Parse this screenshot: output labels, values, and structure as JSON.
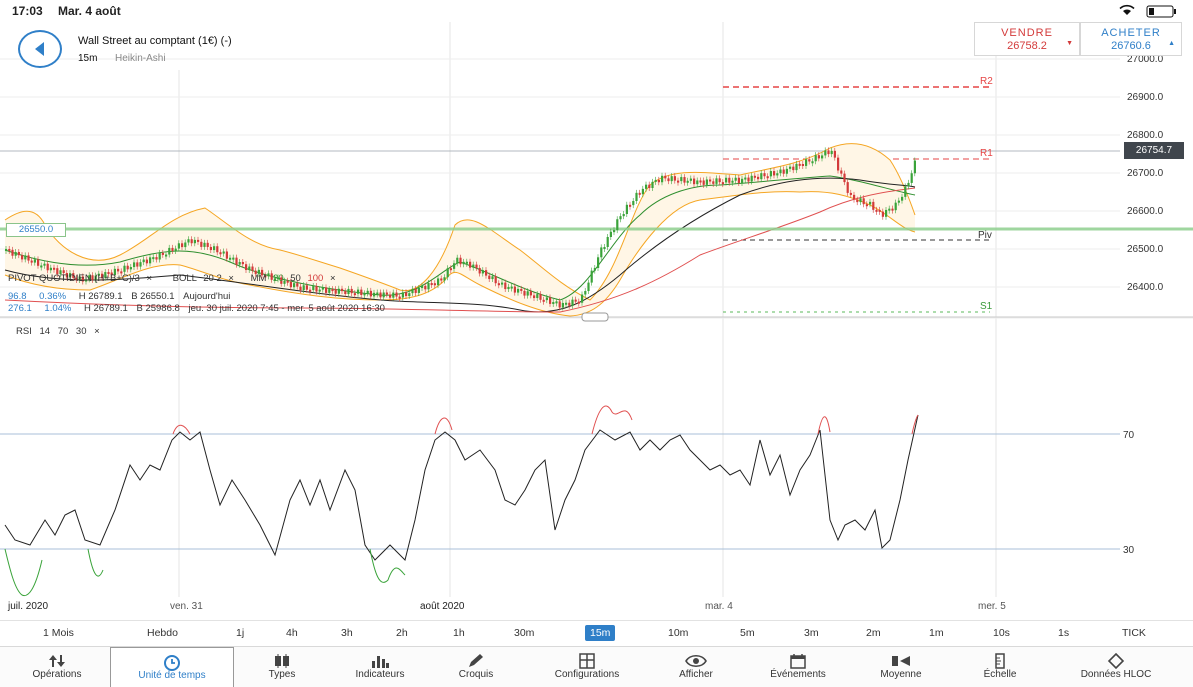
{
  "status_bar": {
    "time": "17:03",
    "date": "Mar. 4 août"
  },
  "header": {
    "instrument": "Wall Street au comptant (1€) (-)",
    "timeframe": "15m",
    "chart_type": "Heikin-Ashi"
  },
  "trade": {
    "sell_label": "VENDRE",
    "sell_price": "26758.2",
    "buy_label": "ACHETER",
    "buy_price": "26760.6"
  },
  "price_axis": {
    "ticks": [
      "27000.0",
      "26900.0",
      "26800.0",
      "26700.0",
      "26600.0",
      "26500.0",
      "26400.0"
    ],
    "current_price": "26754.7",
    "left_label": "26550.0"
  },
  "pivot_labels": {
    "r2": "R2",
    "r1": "R1",
    "piv": "Piv",
    "s1": "S1"
  },
  "indicator_info": {
    "pivot_title": "PIVOT QUOTIDIEN (H+B+C)/3",
    "boll_label": "BOLL",
    "boll_params": "20 2",
    "mm_label": "MM",
    "mm_p1": "20",
    "mm_p2": "50",
    "mm_p3": "100",
    "row1_a": "96.8",
    "row1_b": "0.36%",
    "row1_c": "H 26789.1",
    "row1_d": "B 26550.1",
    "row1_e": "Aujourd'hui",
    "row2_a": "276.1",
    "row2_b": "1.04%",
    "row2_c": "H 26789.1",
    "row2_d": "B 25986.8",
    "row2_e": "jeu. 30 juil. 2020 7:45 - mer. 5 août 2020 16:30"
  },
  "rsi": {
    "label": "RSI",
    "p1": "14",
    "p2": "70",
    "p3": "30",
    "upper": "70",
    "lower": "30"
  },
  "time_axis": [
    "juil. 2020",
    "ven. 31",
    "août 2020",
    "mar. 4",
    "mer. 5"
  ],
  "timeframes": [
    "1 Mois",
    "Hebdo",
    "1j",
    "4h",
    "3h",
    "2h",
    "1h",
    "30m",
    "15m",
    "10m",
    "5m",
    "3m",
    "2m",
    "1m",
    "10s",
    "1s",
    "TICK"
  ],
  "active_timeframe": "15m",
  "toolbar": [
    {
      "label": "Opérations",
      "icon": "operations-icon"
    },
    {
      "label": "Unité de temps",
      "icon": "clock-icon"
    },
    {
      "label": "Types",
      "icon": "candles-icon"
    },
    {
      "label": "Indicateurs",
      "icon": "bars-icon"
    },
    {
      "label": "Croquis",
      "icon": "pencil-icon"
    },
    {
      "label": "Configurations",
      "icon": "layout-icon"
    },
    {
      "label": "Afficher",
      "icon": "eye-icon"
    },
    {
      "label": "Événements",
      "icon": "calendar-icon"
    },
    {
      "label": "Moyenne",
      "icon": "average-icon"
    },
    {
      "label": "Échelle",
      "icon": "scale-icon"
    },
    {
      "label": "Données HLOC",
      "icon": "diamond-icon"
    }
  ],
  "colors": {
    "accent": "#2f7fc8",
    "up": "#3aa33a",
    "down": "#d33a3a",
    "boll": "#f5a623",
    "pivot_line": "#8fcf8f"
  }
}
